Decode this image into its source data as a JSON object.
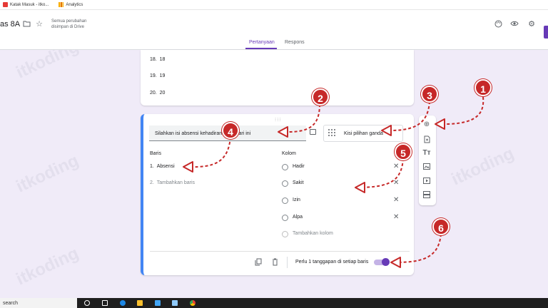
{
  "bookmarks": [
    {
      "label": "Katak Masuk - itko..."
    },
    {
      "label": "Analytics"
    }
  ],
  "header": {
    "title": "as 8A",
    "saved_text": "Semua perubahan disimpan di Drive",
    "tabs": [
      {
        "label": "Pertanyaan",
        "active": true
      },
      {
        "label": "Respons",
        "active": false
      }
    ]
  },
  "prev_question": {
    "options": [
      {
        "num": "18.",
        "label": "18"
      },
      {
        "num": "19.",
        "label": "19"
      },
      {
        "num": "20.",
        "label": "20"
      }
    ]
  },
  "question": {
    "title": "Silahkan isi absensi kehadiran anda hari ini",
    "type_label": "Kisi pilihan ganda",
    "rows_header": "Baris",
    "rows": [
      {
        "num": "1.",
        "label": "Absensi"
      }
    ],
    "add_row": {
      "num": "2.",
      "label": "Tambahkan baris"
    },
    "columns_header": "Kolom",
    "columns": [
      {
        "label": "Hadir"
      },
      {
        "label": "Sakit"
      },
      {
        "label": "Izin"
      },
      {
        "label": "Alpa"
      }
    ],
    "add_column": "Tambahkan kolom",
    "require_label": "Perlu 1 tanggapan di setiap baris",
    "require_on": true
  },
  "side_toolbar": [
    "add-question-icon",
    "import-question-icon",
    "title-text-icon",
    "image-icon",
    "video-icon",
    "section-icon"
  ],
  "annotations": [
    "1",
    "2",
    "3",
    "4",
    "5",
    "6"
  ],
  "watermark": "itkoding",
  "taskbar": {
    "search": "search"
  },
  "colors": {
    "accent": "#673ab7",
    "background": "#f0ebf8",
    "annotation": "#c62828",
    "question_border": "#4285f4"
  }
}
